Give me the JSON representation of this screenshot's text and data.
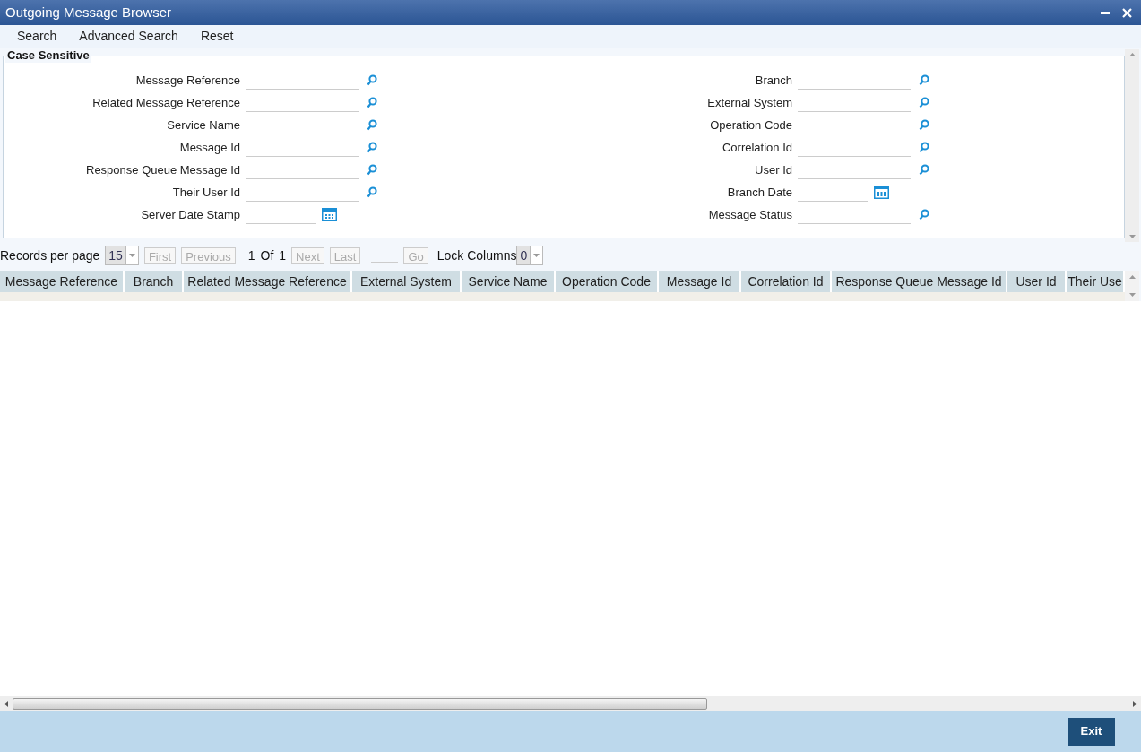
{
  "window": {
    "title": "Outgoing Message Browser"
  },
  "menu": [
    "Search",
    "Advanced Search",
    "Reset"
  ],
  "criteria": {
    "title": "Case Sensitive",
    "left": [
      {
        "label": "Message Reference",
        "kind": "search"
      },
      {
        "label": "Related Message Reference",
        "kind": "search"
      },
      {
        "label": "Service Name",
        "kind": "search"
      },
      {
        "label": "Message Id",
        "kind": "search"
      },
      {
        "label": "Response Queue Message Id",
        "kind": "search"
      },
      {
        "label": "Their User Id",
        "kind": "search"
      },
      {
        "label": "Server Date Stamp",
        "kind": "date"
      }
    ],
    "right": [
      {
        "label": "Branch",
        "kind": "search"
      },
      {
        "label": "External System",
        "kind": "search"
      },
      {
        "label": "Operation Code",
        "kind": "search"
      },
      {
        "label": "Correlation Id",
        "kind": "search"
      },
      {
        "label": "User Id",
        "kind": "search"
      },
      {
        "label": "Branch Date",
        "kind": "date"
      },
      {
        "label": "Message Status",
        "kind": "search"
      }
    ]
  },
  "pagination": {
    "records_label": "Records per page",
    "records_value": "15",
    "nav": [
      {
        "label": "First",
        "disabled": true
      },
      {
        "label": "Previous",
        "disabled": true
      }
    ],
    "page": "1",
    "of": "Of",
    "total": "1",
    "nav2": [
      {
        "label": "Next",
        "disabled": true
      },
      {
        "label": "Last",
        "disabled": true
      }
    ],
    "go": {
      "label": "Go",
      "disabled": true
    },
    "lock_label": "Lock Columns",
    "lock_value": "0"
  },
  "table": {
    "columns": [
      "Message Reference",
      "Branch",
      "Related Message Reference",
      "External System",
      "Service Name",
      "Operation Code",
      "Message Id",
      "Correlation Id",
      "Response Queue Message Id",
      "User Id",
      "Their Use"
    ]
  },
  "footer": {
    "button": "Exit"
  }
}
